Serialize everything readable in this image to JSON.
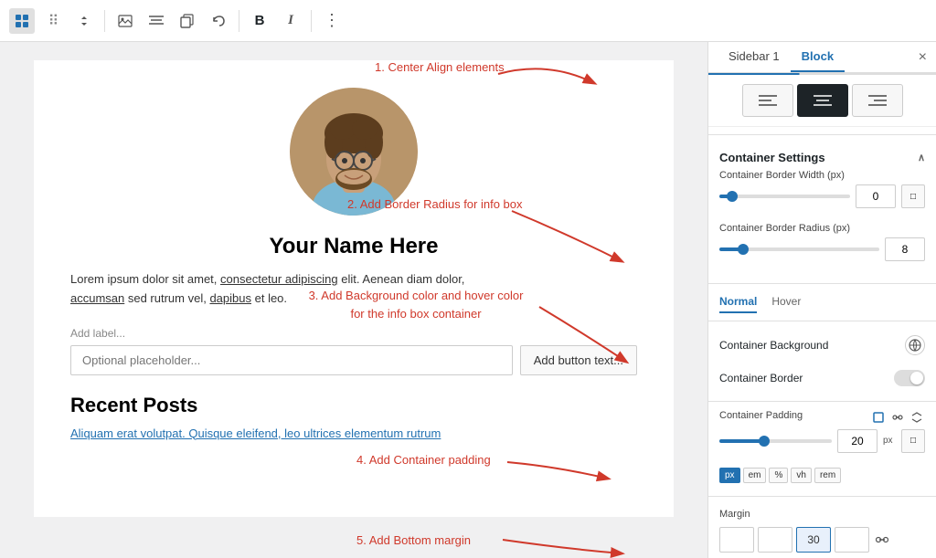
{
  "toolbar": {
    "icons": [
      {
        "name": "block-icon",
        "symbol": "⊞"
      },
      {
        "name": "drag-icon",
        "symbol": "⠿"
      },
      {
        "name": "up-down-icon",
        "symbol": "⇅"
      },
      {
        "name": "image-icon",
        "symbol": "🖼"
      },
      {
        "name": "align-icon",
        "symbol": "≡"
      },
      {
        "name": "copy-icon",
        "symbol": "❐"
      },
      {
        "name": "undo-icon",
        "symbol": "↺"
      },
      {
        "name": "bold-icon",
        "symbol": "B"
      },
      {
        "name": "italic-icon",
        "symbol": "I"
      },
      {
        "name": "more-icon",
        "symbol": "⋮"
      }
    ]
  },
  "editor": {
    "name": "Your Name Here",
    "body": "Lorem ipsum dolor sit amet, consectetur adipiscing elit. Aenean diam dolor,\naccumsan sed rutrum vel, dapibus et leo.",
    "add_label": "Add label...",
    "input_placeholder": "Optional placeholder...",
    "btn_text": "Add button text...",
    "recent_posts_title": "Recent Posts",
    "recent_posts_link": "Aliquam erat volutpat. Quisque eleifend, leo ultrices elementum rutrum"
  },
  "annotations": {
    "label1": "1. Center Align elements",
    "label2": "2. Add Border Radius for info box",
    "label3": "3. Add Background color and hover color\nfor the info box container",
    "label4": "4. Add Container padding",
    "label5": "5. Add Bottom margin"
  },
  "sidebar": {
    "tab1": "Sidebar 1",
    "tab2": "Block",
    "align_buttons": [
      {
        "name": "align-left",
        "symbol": "☰",
        "active": false
      },
      {
        "name": "align-center",
        "symbol": "☰",
        "active": true
      },
      {
        "name": "align-right",
        "symbol": "☰",
        "active": false
      }
    ],
    "container_settings_label": "Container Settings",
    "border_width_label": "Container Border Width (px)",
    "border_width_value": "0",
    "border_radius_label": "Container Border Radius (px)",
    "border_radius_value": "8",
    "normal_tab": "Normal",
    "hover_tab": "Hover",
    "bg_label": "Container Background",
    "border_label": "Container Border",
    "padding_label": "Container Padding",
    "padding_value": "20",
    "padding_unit": "px",
    "unit_buttons": [
      "px",
      "em",
      "%",
      "vh",
      "rem"
    ],
    "margin_label": "Margin",
    "margin_values": [
      "",
      "",
      "30",
      ""
    ]
  }
}
